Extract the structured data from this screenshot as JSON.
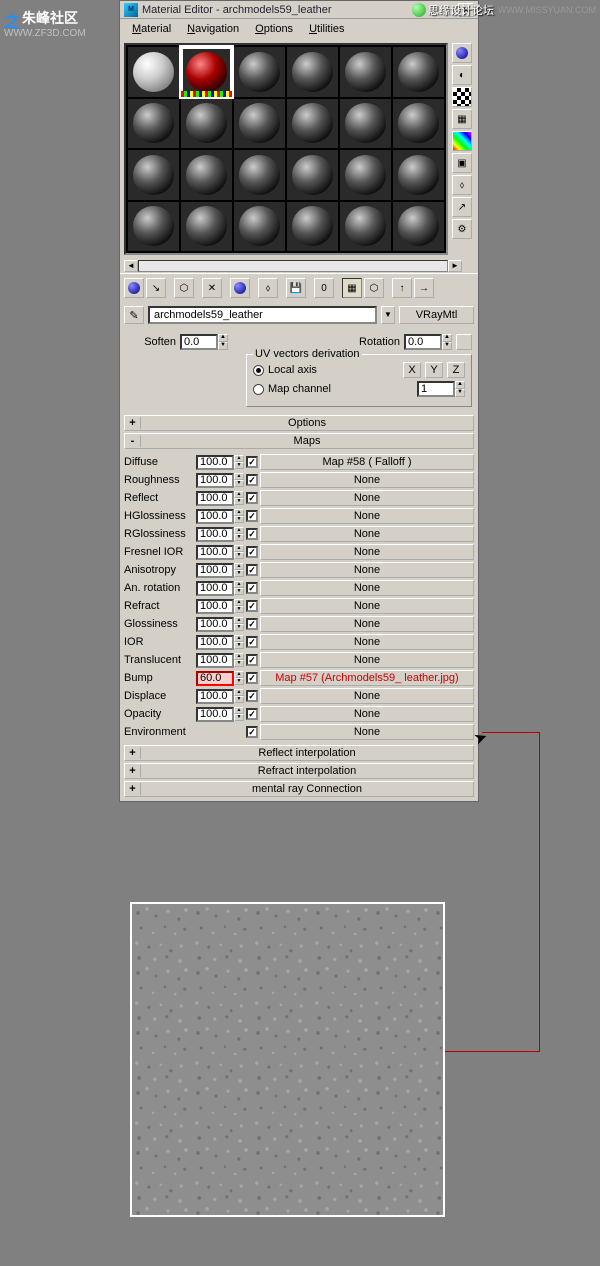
{
  "watermarks": {
    "left_logo": "之",
    "left_text": "朱峰社区",
    "left_url": "WWW.ZF3D.COM",
    "right_text": "思缘设计论坛",
    "right_url": "WWW.MISSYUAN.COM"
  },
  "window": {
    "title": "Material Editor - archmodels59_leather"
  },
  "menu": {
    "material": "Material",
    "navigation": "Navigation",
    "options": "Options",
    "utilities": "Utilities"
  },
  "material_name": "archmodels59_leather",
  "material_type": "VRayMtl",
  "params": {
    "soften_label": "Soften",
    "soften_value": "0.0",
    "rotation_label": "Rotation",
    "rotation_value": "0.0",
    "uv_legend": "UV vectors derivation",
    "local_axis": "Local axis",
    "map_channel": "Map channel",
    "x": "X",
    "y": "Y",
    "z": "Z",
    "channel_value": "1"
  },
  "rollouts": {
    "options": "Options",
    "maps": "Maps",
    "reflect_interp": "Reflect interpolation",
    "refract_interp": "Refract interpolation",
    "mental": "mental ray Connection"
  },
  "maps": [
    {
      "label": "Diffuse",
      "value": "100.0",
      "checked": true,
      "map": "Map #58  ( Falloff )",
      "highlight": false
    },
    {
      "label": "Roughness",
      "value": "100.0",
      "checked": true,
      "map": "None",
      "highlight": false
    },
    {
      "label": "Reflect",
      "value": "100.0",
      "checked": true,
      "map": "None",
      "highlight": false
    },
    {
      "label": "HGlossiness",
      "value": "100.0",
      "checked": true,
      "map": "None",
      "highlight": false
    },
    {
      "label": "RGlossiness",
      "value": "100.0",
      "checked": true,
      "map": "None",
      "highlight": false
    },
    {
      "label": "Fresnel IOR",
      "value": "100.0",
      "checked": true,
      "map": "None",
      "highlight": false
    },
    {
      "label": "Anisotropy",
      "value": "100.0",
      "checked": true,
      "map": "None",
      "highlight": false
    },
    {
      "label": "An. rotation",
      "value": "100.0",
      "checked": true,
      "map": "None",
      "highlight": false
    },
    {
      "label": "Refract",
      "value": "100.0",
      "checked": true,
      "map": "None",
      "highlight": false
    },
    {
      "label": "Glossiness",
      "value": "100.0",
      "checked": true,
      "map": "None",
      "highlight": false
    },
    {
      "label": "IOR",
      "value": "100.0",
      "checked": true,
      "map": "None",
      "highlight": false
    },
    {
      "label": "Translucent",
      "value": "100.0",
      "checked": true,
      "map": "None",
      "highlight": false
    },
    {
      "label": "Bump",
      "value": "60.0",
      "checked": true,
      "map": "Map #57 (Archmodels59_ leather.jpg)",
      "highlight": true
    },
    {
      "label": "Displace",
      "value": "100.0",
      "checked": true,
      "map": "None",
      "highlight": false
    },
    {
      "label": "Opacity",
      "value": "100.0",
      "checked": true,
      "map": "None",
      "highlight": false
    },
    {
      "label": "Environment",
      "value": "",
      "checked": true,
      "map": "None",
      "highlight": false,
      "nospinner": true
    }
  ]
}
